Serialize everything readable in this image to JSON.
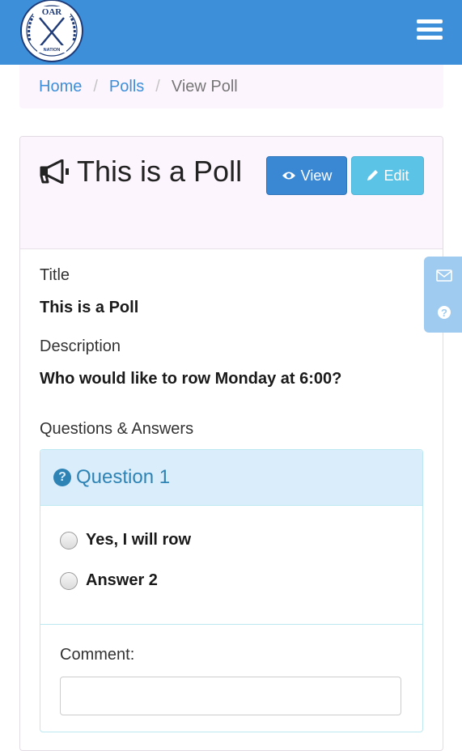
{
  "navbar": {
    "logo_text": "OAR",
    "logo_subtext": "NATION",
    "menu_icon": "hamburger-menu-icon",
    "color": "#3d8fd9"
  },
  "breadcrumb": {
    "items": [
      {
        "label": "Home"
      },
      {
        "label": "Polls"
      },
      {
        "label": "View Poll"
      }
    ],
    "separator": "/"
  },
  "poll": {
    "heading_icon": "megaphone-icon",
    "heading": "This is a Poll",
    "buttons": {
      "view": "View",
      "view_icon": "eye-icon",
      "edit": "Edit",
      "edit_icon": "pencil-icon"
    },
    "title_label": "Title",
    "title_value": "This is a Poll",
    "description_label": "Description",
    "description_value": "Who would like to row Monday at 6:00?",
    "qa_label": "Questions & Answers"
  },
  "question": {
    "icon": "question-circle-icon",
    "title": "Question 1",
    "answers": [
      "Yes, I will row",
      "Answer 2"
    ],
    "comment_label": "Comment:",
    "comment_value": ""
  },
  "side_tab": {
    "icons": [
      "envelope-icon",
      "question-circle-icon"
    ]
  }
}
